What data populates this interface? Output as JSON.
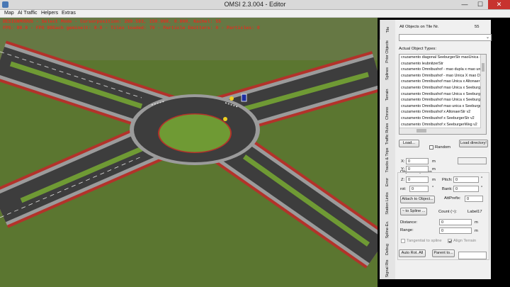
{
  "window": {
    "title": "OMSI 2.3.004 - Editor",
    "min": "—",
    "max": "☐",
    "close": "✕"
  },
  "menu": [
    "Map",
    "AI Traffic",
    "Helpers",
    "Extras"
  ],
  "overlay": {
    "line1": "DESIGNMODUS - Select Mode - Cursorposition: 269.593, 150.098, 0.000, Kachel: 55",
    "line2": "FPS: 99.9 - FPS 99Each geminelt: 9.9 - Tiles loaded: 78 - Particle Emitters: 0 - Particles: 0"
  },
  "tabs": [
    "Tile",
    "Prior Objects",
    "Splines",
    "Terrain",
    "Chrono",
    "Traffic Rules",
    "Tracks & Trips",
    "Error",
    "Station Links",
    "Spline-Ex.",
    "Debug",
    "Signal Rts"
  ],
  "panel": {
    "all_objects_label": "All Objects on Tile Nr.",
    "tile_nr": "55",
    "dropdown_value": "",
    "actual_types_label": "Actual Object Types:",
    "object_types": [
      "cruzamento diagonal SeeburgerStr maoUnica -",
      "cruzamento leubnitzerStr",
      "cruzamento Omnibushof - mao dupla x mao uni",
      "cruzamento Omnibushof - mao Unica X mao Du",
      "cruzamento Omnibushof mao Unica x Altonaer!",
      "cruzamento Omnibushof mao Unica x Seeburge",
      "cruzamento Omnibushof mao Unica x Seeburge",
      "cruzamento Omnibushof mao Unica x Seeburge",
      "cruzamento Omnibushof mao unica x Seeburge",
      "cruzamento Omnibushof x AltonaerStr v2",
      "cruzamento Omnibushof x SeeburgerStr v2",
      "cruzamento Omnibushof x SeeburgerWeg v2",
      "cruzamento Omnibushof x SeeburgerWeg v2"
    ],
    "load_label": "Load...",
    "random_label": "Random",
    "load_directory_label": "Load directory!",
    "object_properties_label": "Object Properties",
    "x_label": "X:",
    "x_value": "0",
    "x_unit": "m",
    "y_label": "Y:",
    "y_value": "0",
    "y_unit": "m",
    "z_label": "Z:",
    "z_value": "0",
    "z_unit": "m",
    "pitch_label": "Pitch:",
    "pitch_value": "0",
    "pitch_unit": "°",
    "rot_label": "rot:",
    "rot_value": "0",
    "rot_unit": "°",
    "bank_label": "Bank:",
    "bank_value": "0",
    "bank_unit": "°",
    "attach_label": "Attach to Object...",
    "attprefix_label": "AttPrefix:",
    "attprefix_value": "0",
    "to_spline_label": "~ to Spline ...",
    "count_label": "Count (~):",
    "label17": "Label17",
    "distance_label": "Distance:",
    "distance_value": "0",
    "distance_unit": "m",
    "range_label": "Range:",
    "range_value": "0",
    "range_unit": "m",
    "tangential_label": "Tangential to spline",
    "align_terrain_label": "Align Terrain",
    "auto_rot_label": "Auto Rot. All",
    "parent_to_label": "Parent to..."
  },
  "colors": {
    "accent_red": "#e03020",
    "panel_bg": "#f0f0f0",
    "grass": "#5f7d2c",
    "asphalt": "#3d3d3d"
  }
}
